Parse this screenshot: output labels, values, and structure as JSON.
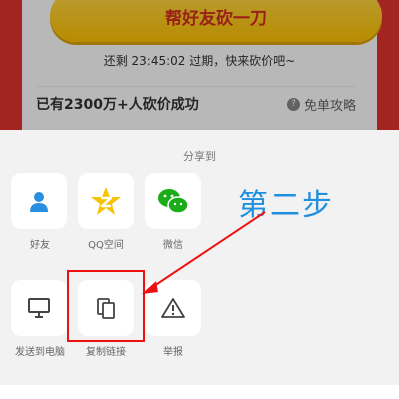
{
  "background_page": {
    "cta_label": "帮好友砍一刀",
    "countdown_text": "还剩 23:45:02 过期，快来砍价吧~",
    "progress_text": "已有2300万+人砍价成功",
    "strategy_label": "免单攻略",
    "strategy_icon": "?"
  },
  "share_sheet": {
    "title": "分享到",
    "row1": [
      {
        "label": "好友",
        "icon": "person-icon"
      },
      {
        "label": "QQ空间",
        "icon": "qzone-star-icon"
      },
      {
        "label": "微信",
        "icon": "wechat-icon"
      }
    ],
    "row2": [
      {
        "label": "发送到电脑",
        "icon": "monitor-icon"
      },
      {
        "label": "复制链接",
        "icon": "copy-icon"
      },
      {
        "label": "举报",
        "icon": "warning-icon"
      }
    ]
  },
  "annotation": {
    "step_text": "第二步",
    "colors": {
      "step": "#1f8fe0",
      "highlight": "#ee1111"
    }
  }
}
